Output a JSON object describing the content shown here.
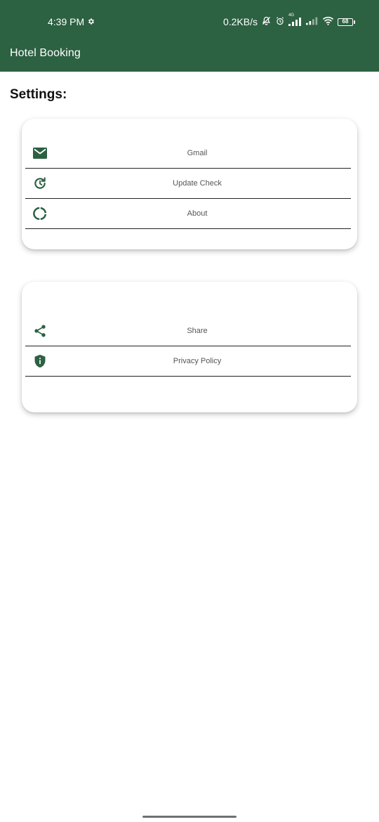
{
  "status_bar": {
    "time": "4:39 PM",
    "net_speed": "0.2KB/s",
    "battery_level": "68",
    "network_type": "4G"
  },
  "app_bar": {
    "title": "Hotel Booking"
  },
  "page": {
    "heading": "Settings:"
  },
  "cards": [
    {
      "items": [
        {
          "label": "Gmail",
          "icon": "mail-icon"
        },
        {
          "label": "Update Check",
          "icon": "update-icon"
        },
        {
          "label": "About",
          "icon": "loading-circle-icon"
        }
      ]
    },
    {
      "items": [
        {
          "label": "Share",
          "icon": "share-icon"
        },
        {
          "label": "Privacy Policy",
          "icon": "shield-info-icon"
        }
      ]
    }
  ],
  "colors": {
    "primary": "#2c6142",
    "divider": "#222222",
    "label_text": "#555555"
  }
}
